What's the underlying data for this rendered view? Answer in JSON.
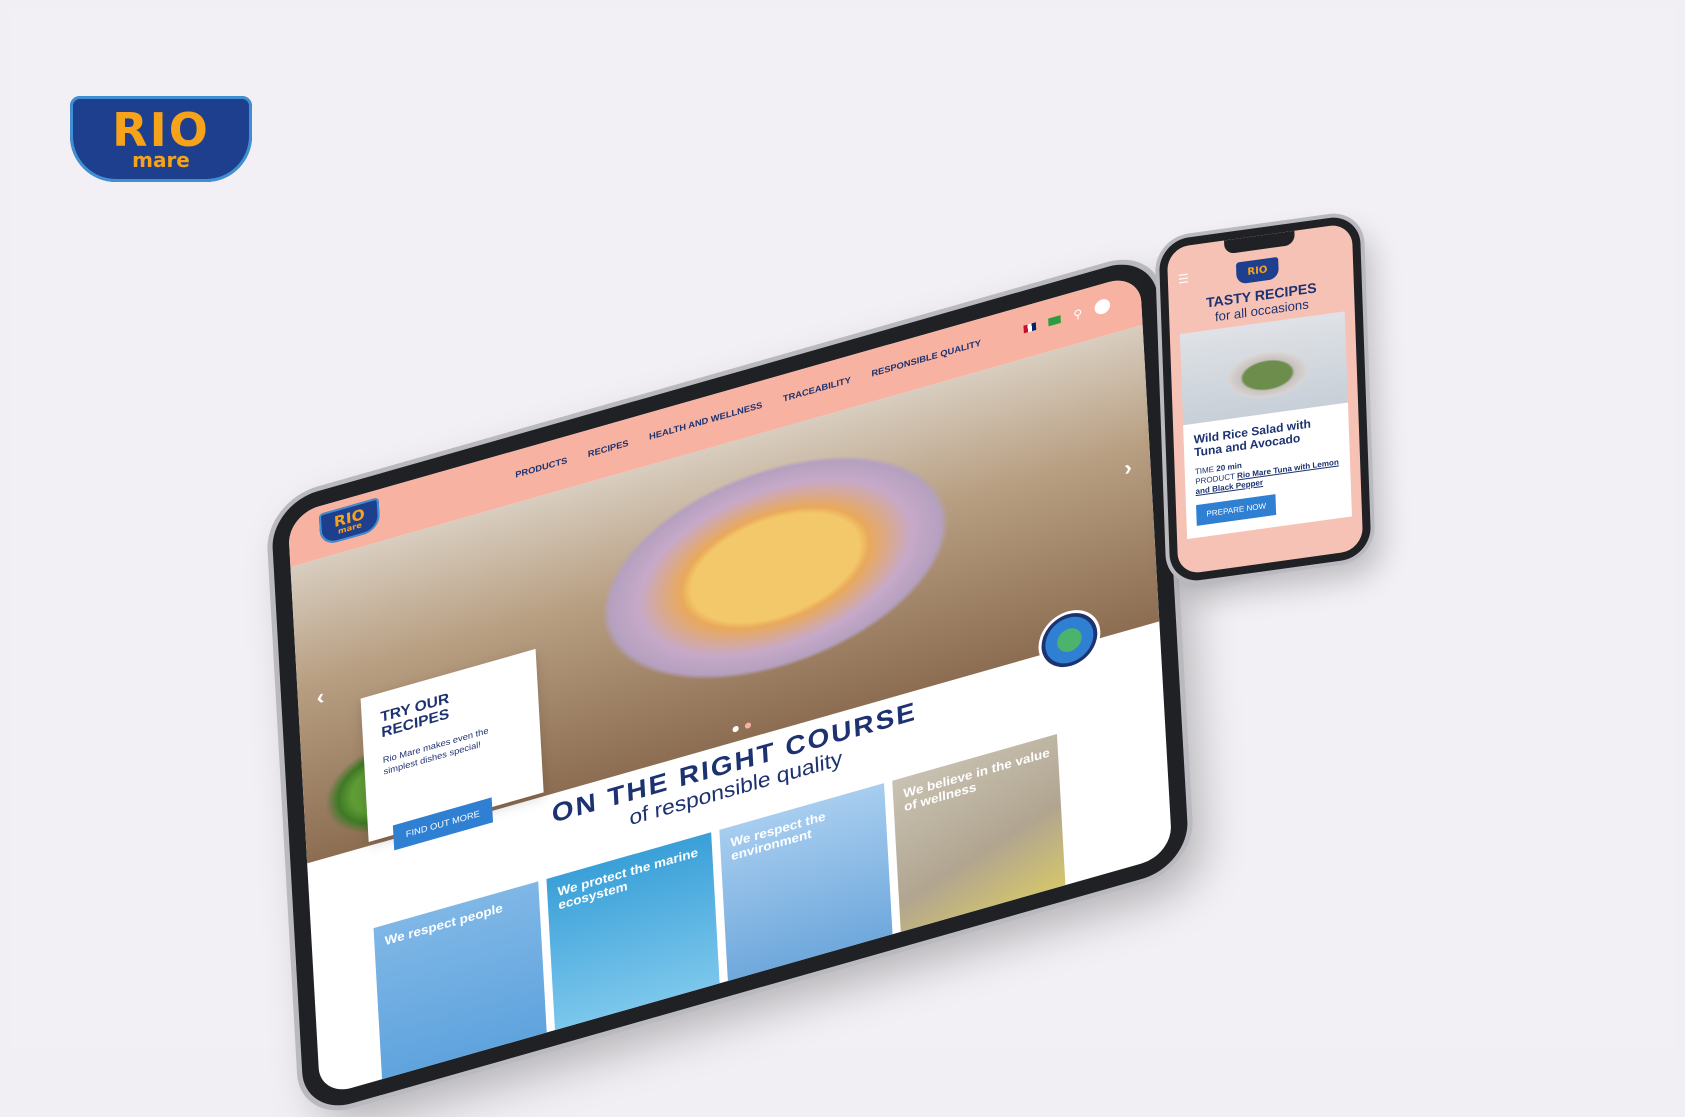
{
  "brand": {
    "name": "RIO",
    "sub": "mare"
  },
  "tablet": {
    "header": {
      "logo_main": "RIO",
      "logo_sub": "mare",
      "nav": [
        "PRODUCTS",
        "RECIPES",
        "HEALTH AND WELLNESS",
        "TRACEABILITY",
        "RESPONSIBLE QUALITY"
      ]
    },
    "hero": {
      "card_title": "TRY OUR RECIPES",
      "card_text": "Rio Mare makes even the simplest dishes special!",
      "card_button": "FIND OUT MORE"
    },
    "section": {
      "title": "ON THE RIGHT COURSE",
      "subtitle": "of responsible quality"
    },
    "tiles": [
      "We respect people",
      "We protect the marine ecosystem",
      "We respect the environment",
      "We believe in the value of wellness"
    ]
  },
  "phone": {
    "title_big": "TASTY RECIPES",
    "title_small": "for all occasions",
    "recipe_title": "Wild Rice Salad with Tuna and Avocado",
    "time_label": "TIME",
    "time_value": "20 min",
    "product_label": "PRODUCT",
    "product_value": "Rio Mare Tuna with Lemon and Black Pepper",
    "button": "PREPARE NOW"
  },
  "colors": {
    "header_pink": "#f7b2a2",
    "brand_blue": "#1d3270",
    "accent_blue": "#2f7fd3",
    "logo_orange": "#f6a21a"
  }
}
